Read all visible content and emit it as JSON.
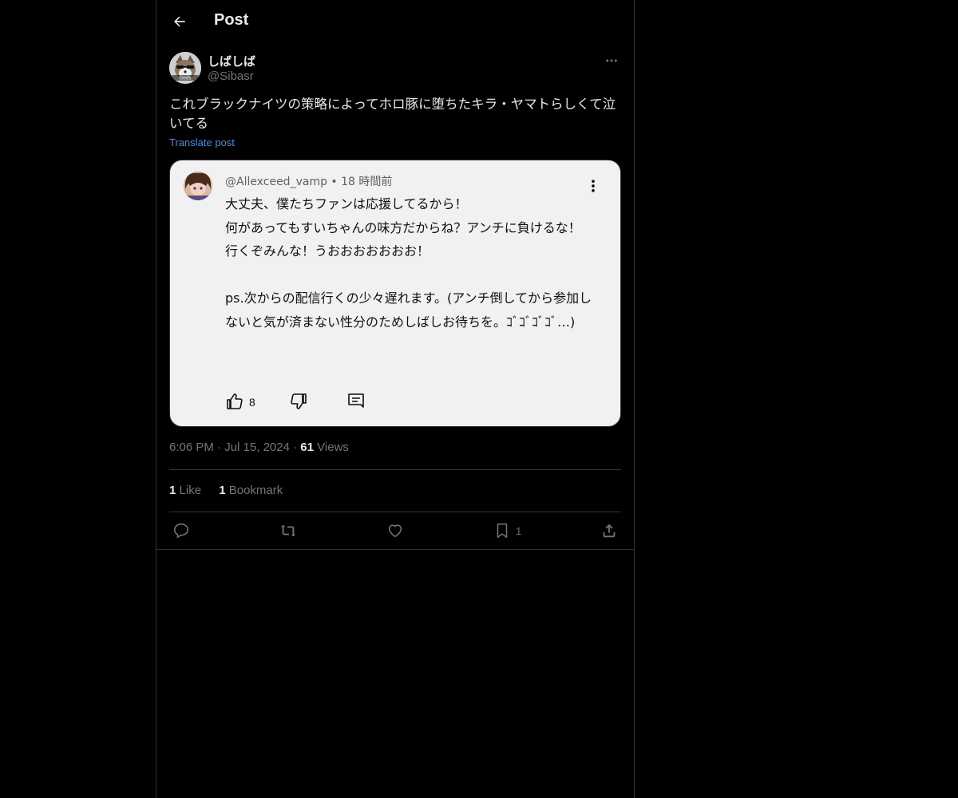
{
  "header": {
    "title": "Post"
  },
  "post": {
    "display_name": "しばしば",
    "handle": "@Sibasr",
    "text": "これブラックナイツの策略によってホロ豚に堕ちたキラ・ヤマトらしくて泣いてる",
    "translate_label": "Translate post",
    "avatar_caption": "Gods"
  },
  "embedded_comment": {
    "author": "@Allexceed_vamp",
    "time": "18 時間前",
    "body": "大丈夫、僕たちファンは応援してるから！\n何があってもすいちゃんの味方だからね？アンチに負けるな！\n行くぞみんな！うおおおおおおお！\n\nps.次からの配信行くの少々遅れます。(アンチ倒してから参加しないと気が済まない性分のためしばしお待ちを。ｺﾞｺﾞｺﾞｺﾞ…)",
    "like_count": "8"
  },
  "meta": {
    "time": "6:06 PM",
    "date": "Jul 15, 2024",
    "views_count": "61",
    "views_label": "Views"
  },
  "stats": {
    "likes_count": "1",
    "likes_label": "Like",
    "bookmarks_count": "1",
    "bookmarks_label": "Bookmark"
  },
  "actions": {
    "bookmark_count": "1"
  },
  "colors": {
    "background": "#000000",
    "text": "#e7e9ea",
    "secondary": "#71767b",
    "link": "#4d8ce0",
    "divider": "#2f3336"
  }
}
